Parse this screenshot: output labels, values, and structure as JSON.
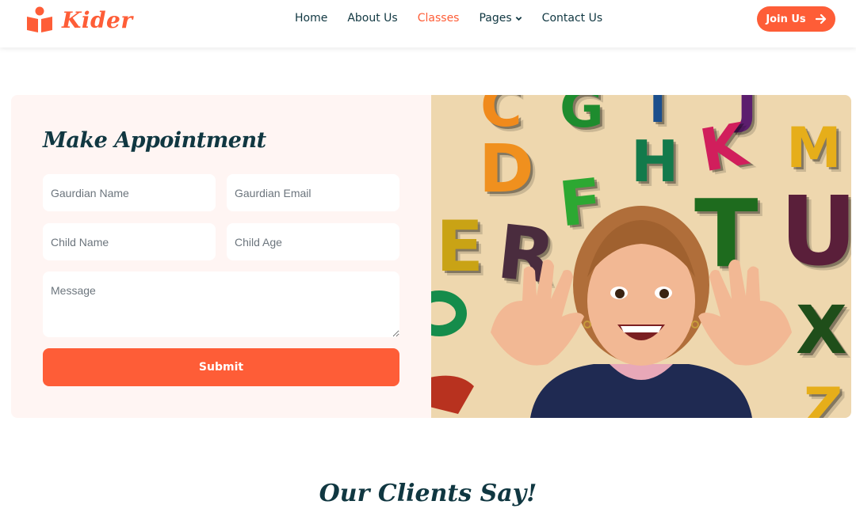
{
  "brand": {
    "name": "Kider",
    "icon": "book-reader-icon",
    "accent_color": "#FE5D37"
  },
  "nav": {
    "items": [
      {
        "label": "Home",
        "active": false
      },
      {
        "label": "About Us",
        "active": false
      },
      {
        "label": "Classes",
        "active": true
      },
      {
        "label": "Pages",
        "active": false,
        "dropdown": true
      },
      {
        "label": "Contact Us",
        "active": false
      }
    ],
    "cta_label": "Join Us",
    "cta_icon": "arrow-right-icon"
  },
  "appointment": {
    "title": "Make Appointment",
    "fields": {
      "guardian_name": "Gaurdian Name",
      "guardian_email": "Gaurdian Email",
      "child_name": "Child Name",
      "child_age": "Child Age",
      "message": "Message"
    },
    "submit_label": "Submit",
    "panel_color": "#FFF5F3"
  },
  "photo": {
    "letters": [
      "C",
      "G",
      "I",
      "J",
      "D",
      "F",
      "H",
      "K",
      "M",
      "E",
      "R",
      "T",
      "U",
      "X",
      "Z"
    ]
  },
  "clients": {
    "title": "Our Clients Say!"
  }
}
